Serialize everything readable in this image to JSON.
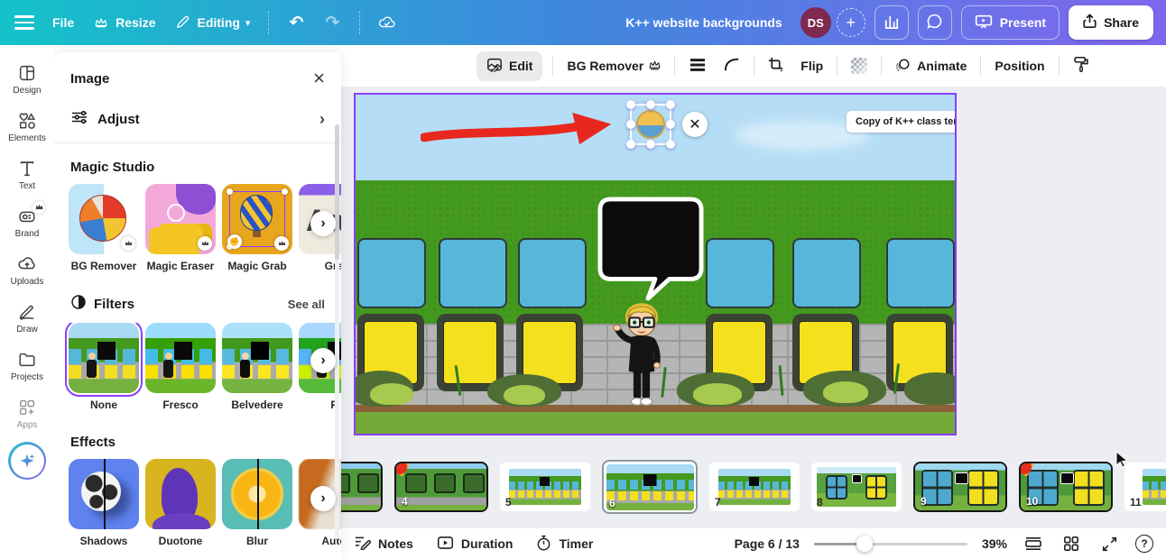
{
  "topbar": {
    "file_label": "File",
    "resize_label": "Resize",
    "editing_label": "Editing",
    "title": "K++ website backgrounds",
    "avatar_initials": "DS",
    "present_label": "Present",
    "share_label": "Share"
  },
  "toolbar": {
    "edit_label": "Edit",
    "bg_remover_label": "BG Remover",
    "flip_label": "Flip",
    "animate_label": "Animate",
    "position_label": "Position"
  },
  "rail": {
    "items": [
      {
        "label": "Design"
      },
      {
        "label": "Elements"
      },
      {
        "label": "Text"
      },
      {
        "label": "Brand"
      },
      {
        "label": "Uploads"
      },
      {
        "label": "Draw"
      },
      {
        "label": "Projects"
      },
      {
        "label": "Apps"
      }
    ]
  },
  "panel": {
    "title": "Image",
    "adjust_label": "Adjust",
    "magic_studio": {
      "heading": "Magic Studio",
      "cards": [
        {
          "label": "BG Remover"
        },
        {
          "label": "Magic Eraser"
        },
        {
          "label": "Magic Grab"
        },
        {
          "label": "Gra"
        }
      ]
    },
    "filters": {
      "heading": "Filters",
      "see_all_label": "See all",
      "selected": "None",
      "items": [
        {
          "label": "None"
        },
        {
          "label": "Fresco"
        },
        {
          "label": "Belvedere"
        },
        {
          "label": "F"
        }
      ]
    },
    "effects": {
      "heading": "Effects",
      "items": [
        {
          "label": "Shadows"
        },
        {
          "label": "Duotone"
        },
        {
          "label": "Blur"
        },
        {
          "label": "Auto"
        }
      ]
    }
  },
  "canvas": {
    "page_label": "Copy of K++ class templa"
  },
  "filmstrip": {
    "thumbnails": [
      {
        "page": ""
      },
      {
        "page": "4"
      },
      {
        "page": "5"
      },
      {
        "page": "6"
      },
      {
        "page": "7"
      },
      {
        "page": "8"
      },
      {
        "page": "9"
      },
      {
        "page": "10"
      },
      {
        "page": "11"
      }
    ],
    "selected_page": "6"
  },
  "statusbar": {
    "notes_label": "Notes",
    "duration_label": "Duration",
    "timer_label": "Timer",
    "page_indicator": "Page 6 / 13",
    "zoom_level": "39%"
  },
  "colors": {
    "accent": "#8b3dff",
    "topbar_gradient": [
      "#14c3c9",
      "#3f88dd",
      "#8066ee"
    ],
    "avatar_bg": "#7d2950",
    "arrow_red": "#e8281e",
    "canvas_sky": "#b5ddf6",
    "canvas_grass": "#44991f",
    "box_blue": "#57b7d8",
    "box_yellow": "#f5e01d"
  }
}
